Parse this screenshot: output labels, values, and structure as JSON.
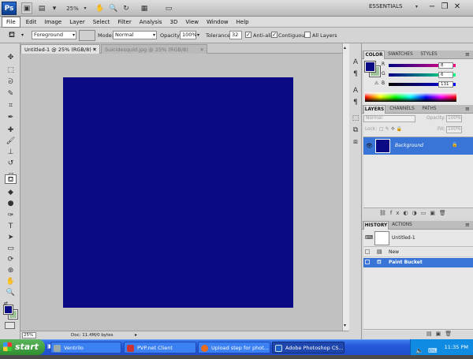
{
  "appbar": {
    "logo": "Ps",
    "zoom": "25%",
    "workspace": "ESSENTIALS",
    "buttons": [
      "Br",
      "Mb",
      "25%",
      "hand",
      "zoom",
      "rotate",
      "grid",
      "screen",
      "arrange"
    ]
  },
  "menu": [
    "File",
    "Edit",
    "Image",
    "Layer",
    "Select",
    "Filter",
    "Analysis",
    "3D",
    "View",
    "Window",
    "Help"
  ],
  "options": {
    "fill_source": "Foreground",
    "mode_label": "Mode:",
    "mode_value": "Normal",
    "opacity_label": "Opacity:",
    "opacity_value": "100%",
    "tolerance_label": "Tolerance:",
    "tolerance_value": "32",
    "antialias_label": "Anti-alias",
    "contiguous_label": "Contiguous",
    "all_layers_label": "All Layers"
  },
  "doc_tabs": [
    {
      "label": "Untitled-1 @ 25% (RGB/8) *"
    },
    {
      "label": "Suicidesquid.jpg @ 25% (RGB/8)"
    }
  ],
  "canvas_color": "#0a0a84",
  "status": {
    "zoom": "25%",
    "doc": "Doc: 11.4M/0 bytes"
  },
  "color_panel": {
    "tabs": [
      "COLOR",
      "SWATCHES",
      "STYLES"
    ],
    "r_label": "R",
    "r_value": "8",
    "g_label": "G",
    "g_value": "6",
    "b_label": "B",
    "b_value": "131"
  },
  "layers_panel": {
    "tabs": [
      "LAYERS",
      "CHANNELS",
      "PATHS"
    ],
    "blend": "Normal",
    "opacity_label": "Opacity:",
    "opacity_value": "100%",
    "lock_label": "Lock:",
    "fill_label": "Fill:",
    "fill_value": "100%",
    "layer_name": "Background"
  },
  "history_panel": {
    "tabs": [
      "HISTORY",
      "ACTIONS"
    ],
    "snapshot": "Untitled-1",
    "states": [
      "New",
      "Paint Bucket"
    ]
  },
  "taskbar": {
    "start": "start",
    "items": [
      {
        "label": "Ventrilo"
      },
      {
        "label": "PVP.net Client"
      },
      {
        "label": "Upload step for phot..."
      },
      {
        "label": "Adobe Photoshop CS..."
      }
    ],
    "clock": "11:35 PM"
  }
}
